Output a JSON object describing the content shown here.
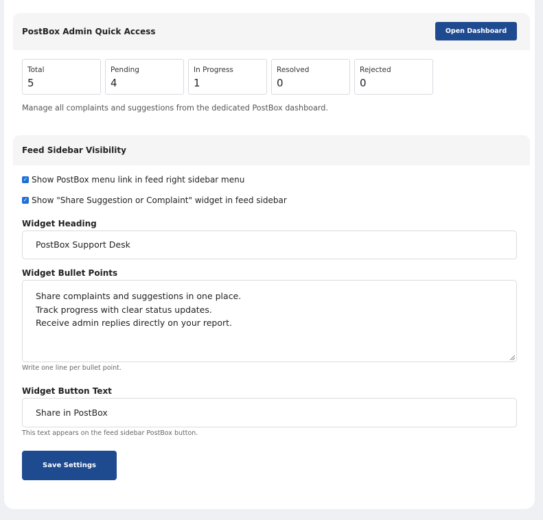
{
  "quick_access": {
    "title": "PostBox Admin Quick Access",
    "open_dashboard_label": "Open Dashboard",
    "stats": [
      {
        "label": "Total",
        "value": "5"
      },
      {
        "label": "Pending",
        "value": "4"
      },
      {
        "label": "In Progress",
        "value": "1"
      },
      {
        "label": "Resolved",
        "value": "0"
      },
      {
        "label": "Rejected",
        "value": "0"
      }
    ],
    "description": "Manage all complaints and suggestions from the dedicated PostBox dashboard."
  },
  "sidebar_visibility": {
    "title": "Feed Sidebar Visibility",
    "checkboxes": [
      {
        "label": "Show PostBox menu link in feed right sidebar menu",
        "checked": true
      },
      {
        "label": "Show \"Share Suggestion or Complaint\" widget in feed sidebar",
        "checked": true
      }
    ],
    "widget_heading": {
      "label": "Widget Heading",
      "value": "PostBox Support Desk"
    },
    "bullet_points": {
      "label": "Widget Bullet Points",
      "lines": [
        "Share complaints and suggestions in one place.",
        "Track progress with clear status updates.",
        "Receive admin replies directly on your report."
      ],
      "help": "Write one line per bullet point."
    },
    "button_text": {
      "label": "Widget Button Text",
      "value": "Share in PostBox",
      "help": "This text appears on the feed sidebar PostBox button."
    },
    "save_label": "Save Settings"
  },
  "colors": {
    "primary": "#1e4a90",
    "checkbox": "#1f6fd8",
    "panel_header": "#f5f5f6",
    "page_background": "#eef0f4"
  }
}
